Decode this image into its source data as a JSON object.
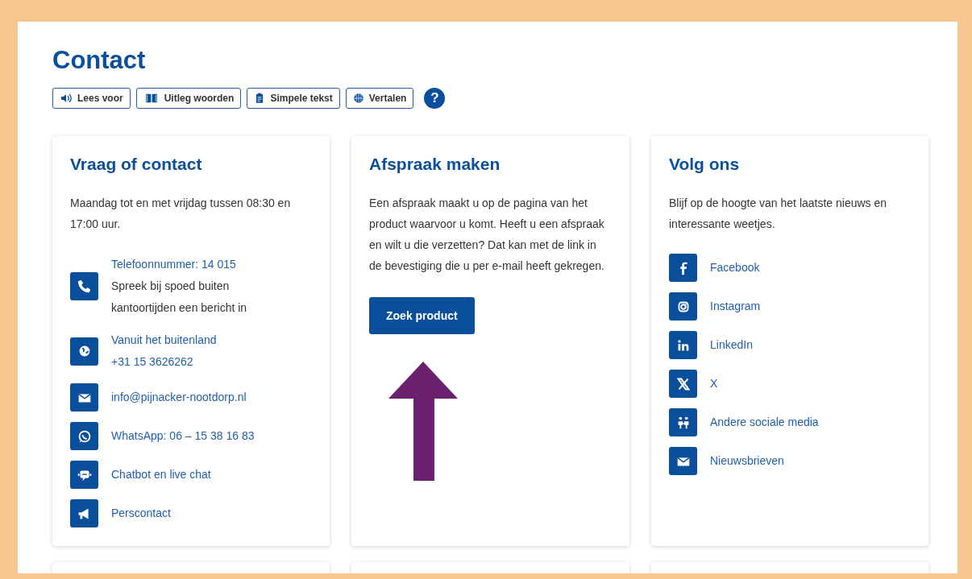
{
  "page": {
    "title": "Contact"
  },
  "toolbar": [
    {
      "label": "Lees voor"
    },
    {
      "label": "Uitleg woorden"
    },
    {
      "label": "Simpele tekst"
    },
    {
      "label": "Vertalen"
    }
  ],
  "help": {
    "label": "?"
  },
  "cards": [
    {
      "title": "Vraag of contact",
      "text": "Maandag tot en met vrijdag tussen 08:30 en 17:00 uur.",
      "items": [
        {
          "lines": [
            {
              "kind": "link",
              "text": "Telefoonnummer: 14 015"
            },
            {
              "kind": "plain",
              "text": "Spreek bij spoed buiten kantoortijden een bericht in"
            }
          ]
        },
        {
          "lines": [
            {
              "kind": "link",
              "text": "Vanuit het buitenland"
            },
            {
              "kind": "link",
              "text": "+31 15 3626262"
            }
          ]
        },
        {
          "lines": [
            {
              "kind": "link",
              "text": "info@pijnacker-nootdorp.nl"
            }
          ]
        },
        {
          "lines": [
            {
              "kind": "link",
              "text": "WhatsApp: 06 – 15 38 16 83"
            }
          ]
        },
        {
          "lines": [
            {
              "kind": "link",
              "text": "Chatbot en live chat"
            }
          ]
        },
        {
          "lines": [
            {
              "kind": "link",
              "text": "Perscontact"
            }
          ]
        }
      ]
    },
    {
      "title": "Afspraak maken",
      "text": "Een afspraak maakt u op de pagina van het product waarvoor u komt. Heeft u een afspraak en wilt u die verzetten? Dat kan met de link in de bevestiging die u per e-mail heeft gekregen.",
      "button": "Zoek product"
    },
    {
      "title": "Volg ons",
      "text": "Blijf op de hoogte van het laatste nieuws en interessante weetjes.",
      "items": [
        {
          "lines": [
            {
              "kind": "link",
              "text": "Facebook"
            }
          ]
        },
        {
          "lines": [
            {
              "kind": "link",
              "text": "Instagram"
            }
          ]
        },
        {
          "lines": [
            {
              "kind": "link",
              "text": "LinkedIn"
            }
          ]
        },
        {
          "lines": [
            {
              "kind": "link",
              "text": "X"
            }
          ]
        },
        {
          "lines": [
            {
              "kind": "link",
              "text": "Andere sociale media"
            }
          ]
        },
        {
          "lines": [
            {
              "kind": "link",
              "text": "Nieuwsbrieven"
            }
          ]
        }
      ]
    }
  ]
}
